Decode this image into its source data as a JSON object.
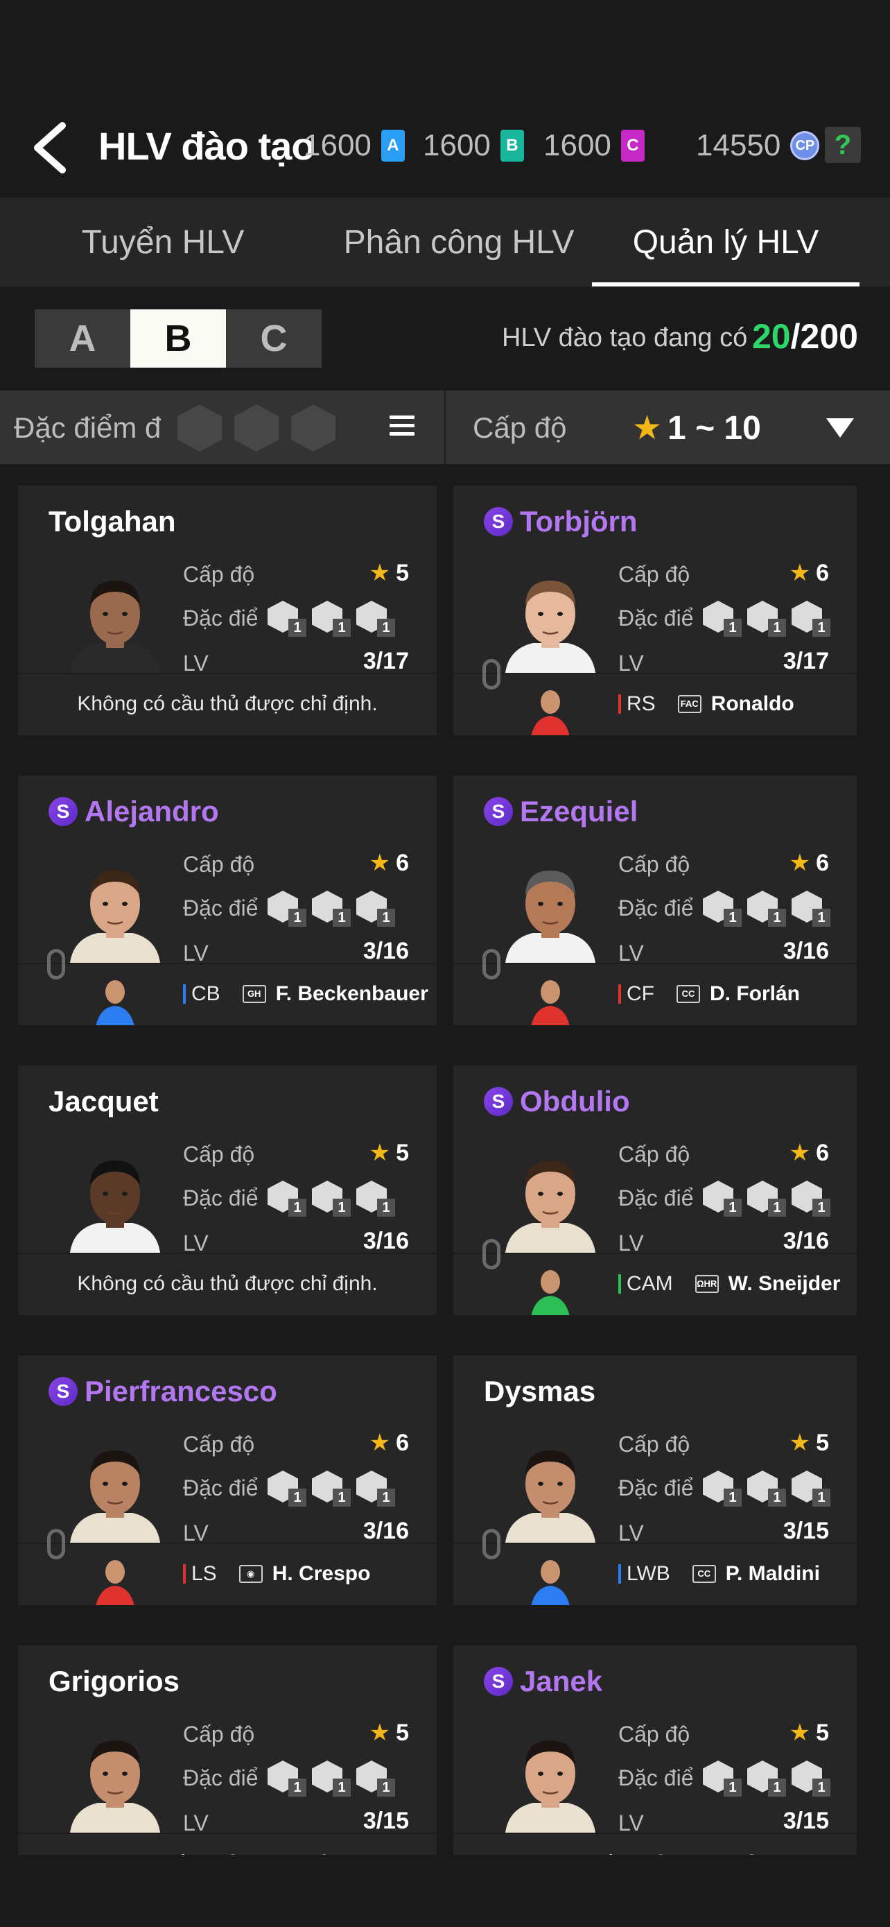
{
  "header": {
    "title": "HLV đào tạo",
    "tickets": [
      {
        "value": "1600",
        "letter": "A",
        "color": "#2a9df4"
      },
      {
        "value": "1600",
        "letter": "B",
        "color": "#18b79b"
      },
      {
        "value": "1600",
        "letter": "C",
        "color": "#c528c4"
      }
    ],
    "cp": {
      "value": "14550",
      "label": "CP"
    },
    "help": "?"
  },
  "tabs": [
    {
      "label": "Tuyển HLV",
      "active": false
    },
    {
      "label": "Phân công HLV",
      "active": false
    },
    {
      "label": "Quản lý HLV",
      "active": true
    }
  ],
  "grades": [
    {
      "label": "A",
      "active": false
    },
    {
      "label": "B",
      "active": true
    },
    {
      "label": "C",
      "active": false
    }
  ],
  "coach_count": {
    "label": "HLV đào tạo đang có",
    "current": "20",
    "max": "/200"
  },
  "filter": {
    "traits_label": "Đặc điểm đ",
    "level_label": "Cấp độ",
    "level_value": "1 ~ 10",
    "star": "★"
  },
  "labels": {
    "level": "Cấp độ",
    "traits": "Đặc điểm",
    "lv": "LV",
    "no_player": "Không có cầu thủ được chỉ định."
  },
  "cards": [
    {
      "name": "Tolgahan",
      "special": false,
      "stars": "5",
      "lv": "3/17",
      "traits": [
        "1",
        "1",
        "1"
      ],
      "player": null,
      "skin": "#9a6a4e",
      "hair": "#1b1410",
      "shirt": "#2a2a2a"
    },
    {
      "name": "Torbjörn",
      "special": true,
      "stars": "6",
      "lv": "3/17",
      "traits": [
        "1",
        "1",
        "1"
      ],
      "player": {
        "position": "RS",
        "pos_color": "#e0322f",
        "club": "FAC",
        "name": "Ronaldo"
      },
      "skin": "#e6b89c",
      "hair": "#7a5438",
      "shirt": "#f2f2f2"
    },
    {
      "name": "Alejandro",
      "special": true,
      "stars": "6",
      "lv": "3/16",
      "traits": [
        "1",
        "1",
        "1"
      ],
      "player": {
        "position": "CB",
        "pos_color": "#2d7df2",
        "club": "GH",
        "name": "F. Beckenbauer"
      },
      "skin": "#d9a788",
      "hair": "#3b2617",
      "shirt": "#e9e0cf"
    },
    {
      "name": "Ezequiel",
      "special": true,
      "stars": "6",
      "lv": "3/16",
      "traits": [
        "1",
        "1",
        "1"
      ],
      "player": {
        "position": "CF",
        "pos_color": "#e0322f",
        "club": "CC",
        "name": "D. Forlán"
      },
      "skin": "#b47a58",
      "hair": "#5b5b5b",
      "shirt": "#f2f2f2"
    },
    {
      "name": "Jacquet",
      "special": false,
      "stars": "5",
      "lv": "3/16",
      "traits": [
        "1",
        "1",
        "1"
      ],
      "player": null,
      "skin": "#5b3a28",
      "hair": "#111111",
      "shirt": "#f2f2f2"
    },
    {
      "name": "Obdulio",
      "special": true,
      "stars": "6",
      "lv": "3/16",
      "traits": [
        "1",
        "1",
        "1"
      ],
      "player": {
        "position": "CAM",
        "pos_color": "#2dbf55",
        "club": "ΩHR",
        "name": "W. Sneijder"
      },
      "skin": "#d9a788",
      "hair": "#3b2617",
      "shirt": "#e9e0cf"
    },
    {
      "name": "Pierfrancesco",
      "special": true,
      "stars": "6",
      "lv": "3/16",
      "traits": [
        "1",
        "1",
        "1"
      ],
      "player": {
        "position": "LS",
        "pos_color": "#e0322f",
        "club": "◉",
        "name": "H. Crespo"
      },
      "skin": "#b98263",
      "hair": "#1b1410",
      "shirt": "#e9e0cf"
    },
    {
      "name": "Dysmas",
      "special": false,
      "stars": "5",
      "lv": "3/15",
      "traits": [
        "1",
        "1",
        "1"
      ],
      "player": {
        "position": "LWB",
        "pos_color": "#2d7df2",
        "club": "CC",
        "name": "P. Maldini"
      },
      "skin": "#c58e6e",
      "hair": "#1b1410",
      "shirt": "#e9e0cf"
    },
    {
      "name": "Grigorios",
      "special": false,
      "stars": "5",
      "lv": "3/15",
      "traits": [
        "1",
        "1",
        "1"
      ],
      "player": null,
      "skin": "#c58e6e",
      "hair": "#1b1410",
      "shirt": "#e9e0cf"
    },
    {
      "name": "Janek",
      "special": true,
      "stars": "5",
      "lv": "3/15",
      "traits": [
        "1",
        "1",
        "1"
      ],
      "player": null,
      "skin": "#d9a788",
      "hair": "#1b1410",
      "shirt": "#e9e0cf"
    }
  ]
}
